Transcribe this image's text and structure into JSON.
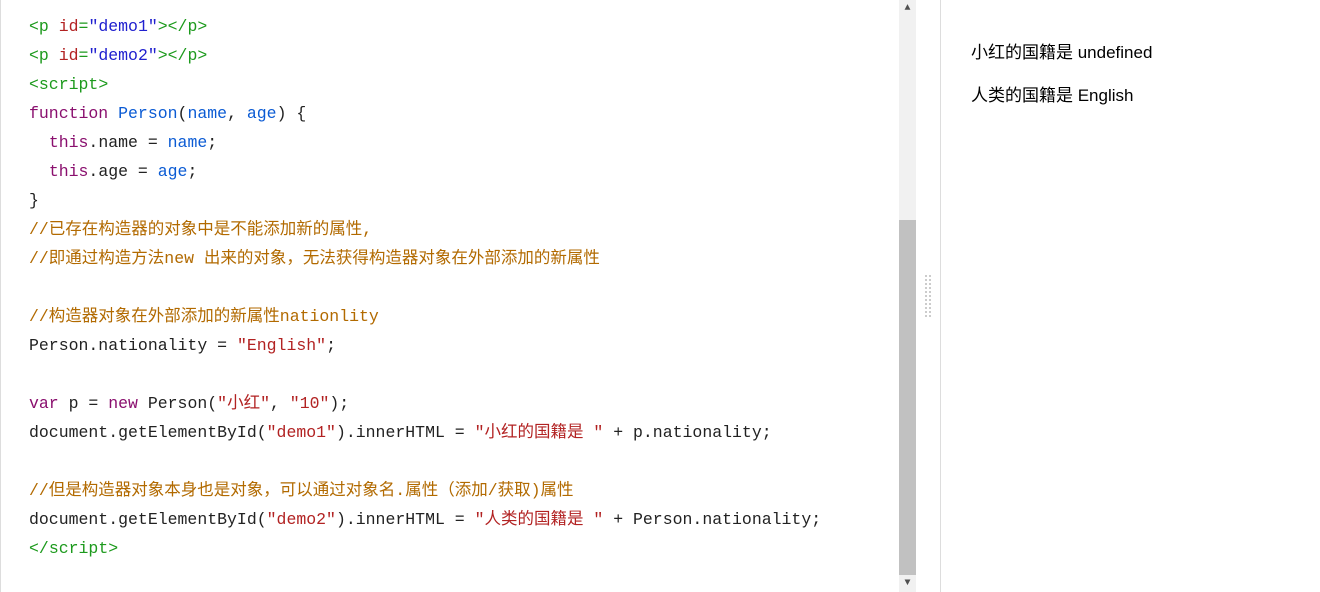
{
  "code": {
    "line1": {
      "open": "<",
      "tag": "p",
      "attr": " id",
      "eq": "=",
      "val": "\"demo1\"",
      "close": ">",
      "open2": "</",
      "close2": ">"
    },
    "line2": {
      "open": "<",
      "tag": "p",
      "attr": " id",
      "eq": "=",
      "val": "\"demo2\"",
      "close": ">",
      "open2": "</",
      "close2": ">"
    },
    "line3": {
      "open": "<",
      "tag": "script",
      "close": ">"
    },
    "line4": {
      "kw": "function",
      "sp": " ",
      "fn": "Person",
      "op": "(",
      "p1": "name",
      "c": ", ",
      "p2": "age",
      "cp": ") {"
    },
    "line5": {
      "indent": "  ",
      "this": "this",
      "dot": ".name = ",
      "var": "name",
      "sc": ";"
    },
    "line6": {
      "indent": "  ",
      "this": "this",
      "dot": ".age = ",
      "var": "age",
      "sc": ";"
    },
    "line7": {
      "txt": "}"
    },
    "line8": {
      "cmt": "//已存在构造器的对象中是不能添加新的属性,"
    },
    "line9": {
      "cmt": "//即通过构造方法new 出来的对象，无法获得构造器对象在外部添加的新属性"
    },
    "blank1": "",
    "line10": {
      "cmt": "//构造器对象在外部添加的新属性nationlity"
    },
    "line11": {
      "lhs": "Person.nationality = ",
      "str": "\"English\"",
      "sc": ";"
    },
    "blank2": "",
    "line12": {
      "kw": "var",
      "sp": " p = ",
      "new": "new",
      "sp2": " Person(",
      "s1": "\"小红\"",
      "c": ", ",
      "s2": "\"10\"",
      "cp": ");"
    },
    "line13": {
      "lhs": "document.getElementById(",
      "arg": "\"demo1\"",
      "mid": ").innerHTML = ",
      "str": "\"小红的国籍是 \"",
      "plus": " + p.nationality;"
    },
    "blank3": "",
    "line14": {
      "cmt": "//但是构造器对象本身也是对象，可以通过对象名.属性（添加/获取)属性"
    },
    "line15": {
      "lhs": "document.getElementById(",
      "arg": "\"demo2\"",
      "mid": ").innerHTML = ",
      "str": "\"人类的国籍是 \"",
      "plus": " + Person.nationality;"
    },
    "line16": {
      "open": "</",
      "tag": "script",
      "close": ">"
    }
  },
  "output": {
    "line1": "小红的国籍是 undefined",
    "line2": "人类的国籍是 English"
  }
}
